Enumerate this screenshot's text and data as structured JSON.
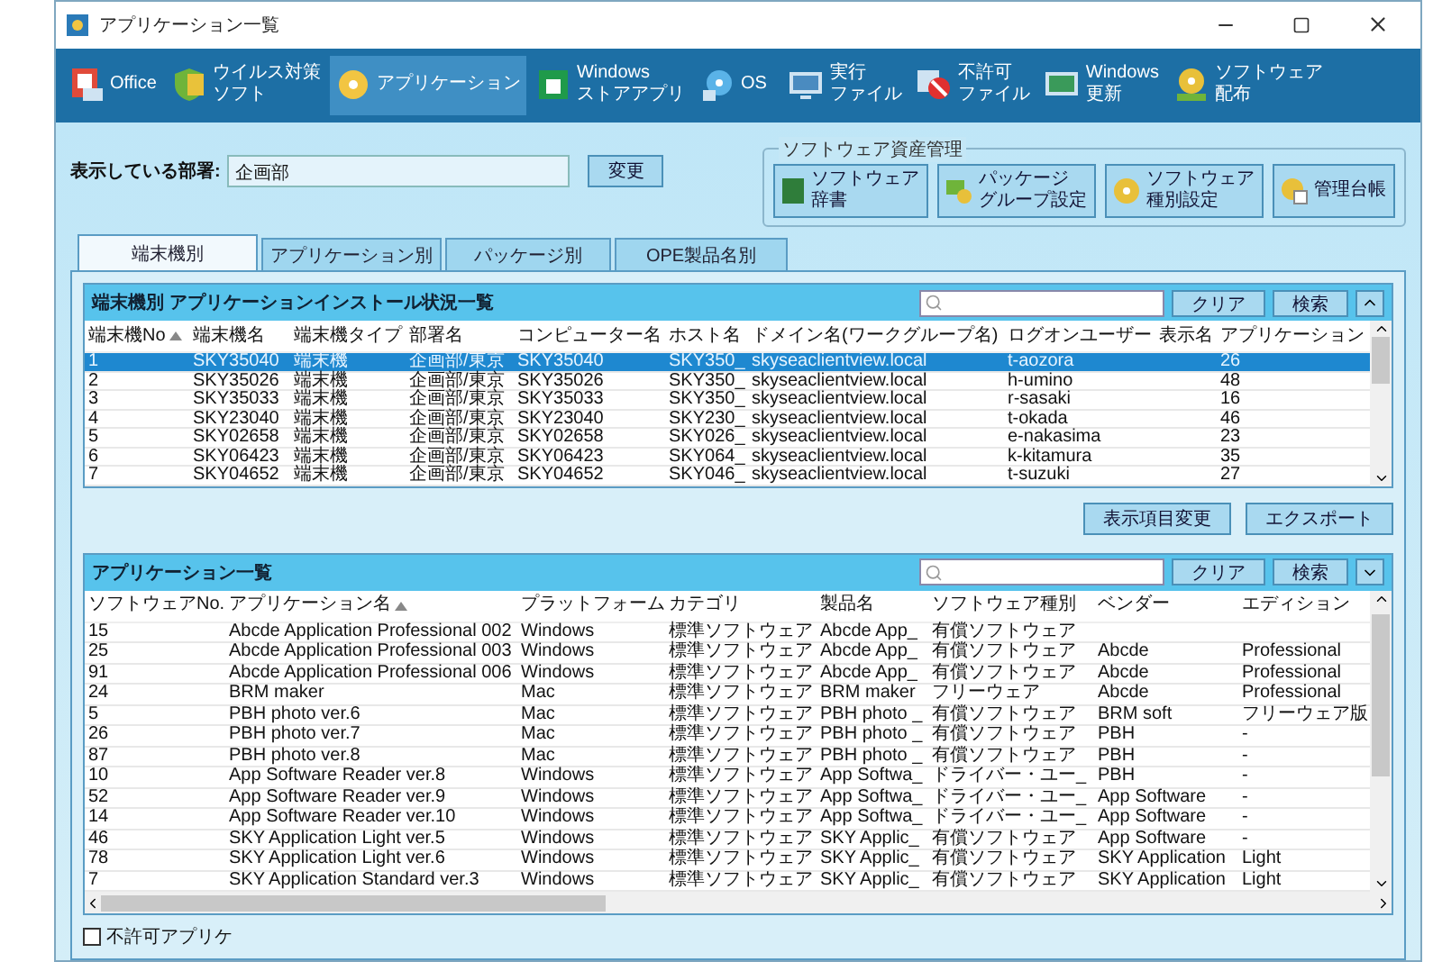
{
  "window": {
    "title": "アプリケーション一覧"
  },
  "toolbar": [
    {
      "lines": [
        "Office"
      ],
      "selected": false
    },
    {
      "lines": [
        "ウイルス対策",
        "ソフト"
      ],
      "selected": false
    },
    {
      "lines": [
        "アプリケーション"
      ],
      "selected": true
    },
    {
      "lines": [
        "Windows",
        "ストアアプリ"
      ],
      "selected": false
    },
    {
      "lines": [
        "OS"
      ],
      "selected": false
    },
    {
      "lines": [
        "実行",
        "ファイル"
      ],
      "selected": false
    },
    {
      "lines": [
        "不許可",
        "ファイル"
      ],
      "selected": false
    },
    {
      "lines": [
        "Windows",
        "更新"
      ],
      "selected": false
    },
    {
      "lines": [
        "ソフトウェア",
        "配布"
      ],
      "selected": false
    }
  ],
  "department": {
    "label": "表示している部署:",
    "value": "企画部",
    "button": "変更"
  },
  "asset_management": {
    "legend": "ソフトウェア資産管理",
    "buttons": [
      [
        "ソフトウェア",
        "辞書"
      ],
      [
        "パッケージ",
        "グループ設定"
      ],
      [
        "ソフトウェア",
        "種別設定"
      ],
      [
        "管理台帳"
      ]
    ]
  },
  "tabs": [
    {
      "label": "端末機別",
      "selected": true
    },
    {
      "label": "アプリケーション別",
      "selected": false
    },
    {
      "label": "パッケージ別",
      "selected": false
    },
    {
      "label": "OPE製品名別",
      "selected": false
    }
  ],
  "upper_table": {
    "title": "端末機別 アプリケーションインストール状況一覧",
    "clear": "クリア",
    "search": "検索",
    "columns": [
      "端末機No",
      "端末機名",
      "端末機タイプ",
      "部署名",
      "コンピューター名",
      "ホスト名",
      "ドメイン名(ワークグループ名)",
      "ログオンユーザー",
      "表示名",
      "アプリケーション"
    ],
    "rows": [
      {
        "selected": true,
        "cells": [
          "1",
          "SKY35040",
          "端末機",
          "企画部/東京",
          "SKY35040",
          "SKY350_",
          "skyseaclientview.local",
          "t-aozora",
          "",
          "26"
        ]
      },
      {
        "selected": false,
        "cells": [
          "2",
          "SKY35026",
          "端末機",
          "企画部/東京",
          "SKY35026",
          "SKY350_",
          "skyseaclientview.local",
          "h-umino",
          "",
          "48"
        ]
      },
      {
        "selected": false,
        "cells": [
          "3",
          "SKY35033",
          "端末機",
          "企画部/東京",
          "SKY35033",
          "SKY350_",
          "skyseaclientview.local",
          "r-sasaki",
          "",
          "16"
        ]
      },
      {
        "selected": false,
        "cells": [
          "4",
          "SKY23040",
          "端末機",
          "企画部/東京",
          "SKY23040",
          "SKY230_",
          "skyseaclientview.local",
          "t-okada",
          "",
          "46"
        ]
      },
      {
        "selected": false,
        "cells": [
          "5",
          "SKY02658",
          "端末機",
          "企画部/東京",
          "SKY02658",
          "SKY026_",
          "skyseaclientview.local",
          "e-nakasima",
          "",
          "23"
        ]
      },
      {
        "selected": false,
        "cells": [
          "6",
          "SKY06423",
          "端末機",
          "企画部/東京",
          "SKY06423",
          "SKY064_",
          "skyseaclientview.local",
          "k-kitamura",
          "",
          "35"
        ]
      },
      {
        "selected": false,
        "cells": [
          "7",
          "SKY04652",
          "端末機",
          "企画部/東京",
          "SKY04652",
          "SKY046_",
          "skyseaclientview.local",
          "t-suzuki",
          "",
          "27"
        ]
      }
    ],
    "actions": [
      "表示項目変更",
      "エクスポート"
    ]
  },
  "lower_table": {
    "title": "アプリケーション一覧",
    "clear": "クリア",
    "search": "検索",
    "columns": [
      "ソフトウェアNo.",
      "アプリケーション名",
      "プラットフォーム",
      "カテゴリ",
      "製品名",
      "ソフトウェア種別",
      "ベンダー",
      "エディション"
    ],
    "rows": [
      [
        "15",
        "Abcde Application Professional 002",
        "Windows",
        "標準ソフトウェア",
        "Abcde App_",
        "有償ソフトウェア",
        "",
        ""
      ],
      [
        "25",
        "Abcde Application Professional 003",
        "Windows",
        "標準ソフトウェア",
        "Abcde App_",
        "有償ソフトウェア",
        "Abcde",
        "Professional"
      ],
      [
        "91",
        "Abcde Application Professional 006",
        "Windows",
        "標準ソフトウェア",
        "Abcde App_",
        "有償ソフトウェア",
        "Abcde",
        "Professional"
      ],
      [
        "24",
        "BRM maker",
        "Mac",
        "標準ソフトウェア",
        "BRM maker",
        "フリーウェア",
        "Abcde",
        "Professional"
      ],
      [
        "5",
        "PBH photo ver.6",
        "Mac",
        "標準ソフトウェア",
        "PBH photo _",
        "有償ソフトウェア",
        "BRM soft",
        "フリーウェア版"
      ],
      [
        "26",
        "PBH photo ver.7",
        "Mac",
        "標準ソフトウェア",
        "PBH photo _",
        "有償ソフトウェア",
        "PBH",
        "-"
      ],
      [
        "87",
        "PBH photo ver.8",
        "Mac",
        "標準ソフトウェア",
        "PBH photo _",
        "有償ソフトウェア",
        "PBH",
        "-"
      ],
      [
        "10",
        "App Software Reader ver.8",
        "Windows",
        "標準ソフトウェア",
        "App Softwa_",
        "ドライバー・ユー_",
        "PBH",
        "-"
      ],
      [
        "52",
        "App Software Reader ver.9",
        "Windows",
        "標準ソフトウェア",
        "App Softwa_",
        "ドライバー・ユー_",
        "App Software",
        "-"
      ],
      [
        "14",
        "App Software Reader ver.10",
        "Windows",
        "標準ソフトウェア",
        "App Softwa_",
        "ドライバー・ユー_",
        "App Software",
        "-"
      ],
      [
        "46",
        "SKY Application Light ver.5",
        "Windows",
        "標準ソフトウェア",
        "SKY Applic_",
        "有償ソフトウェア",
        "App Software",
        "-"
      ],
      [
        "78",
        "SKY Application Light ver.6",
        "Windows",
        "標準ソフトウェア",
        "SKY Applic_",
        "有償ソフトウェア",
        "SKY Application",
        "Light"
      ],
      [
        "7",
        "SKY Application Standard ver.3",
        "Windows",
        "標準ソフトウェア",
        "SKY Applic_",
        "有償ソフトウェア",
        "SKY Application",
        "Light"
      ]
    ]
  },
  "filter": {
    "label": "不許可アプリケ",
    "checked": false
  }
}
